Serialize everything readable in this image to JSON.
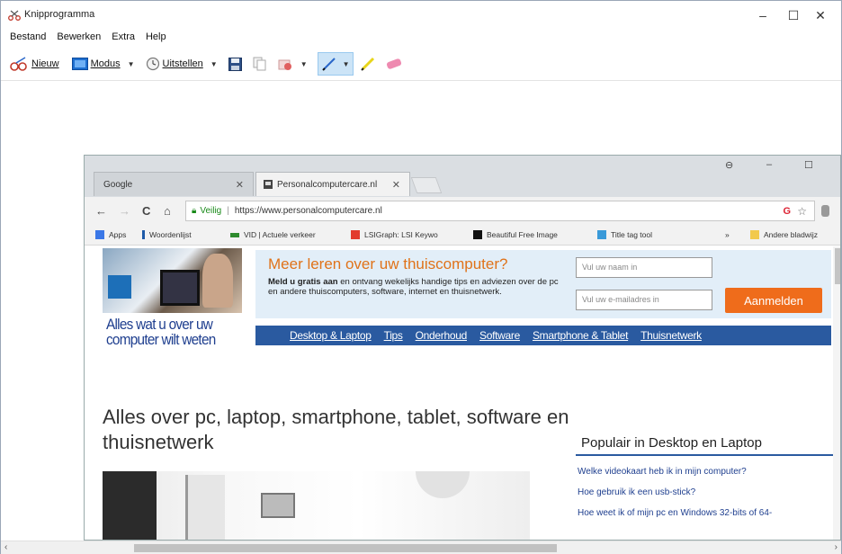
{
  "window": {
    "title": "Knipprogramma",
    "controls": [
      "–",
      "☐",
      "✕"
    ]
  },
  "menu": [
    "Bestand",
    "Bewerken",
    "Extra",
    "Help"
  ],
  "toolbar": {
    "new_label": "Nieuw",
    "mode_label": "Modus",
    "delay_label": "Uitstellen"
  },
  "browser": {
    "tabs": [
      {
        "label": "Google",
        "close": "✕"
      },
      {
        "label": "Personalcomputercare.nl",
        "close": "✕"
      }
    ],
    "window_controls": [
      "⊖",
      "–",
      "☐"
    ],
    "nav": {
      "back": "←",
      "forward": "→",
      "reload": "C",
      "home": "⌂"
    },
    "address": {
      "secure_label": "Veilig",
      "url": "https://www.personalcomputercare.nl"
    },
    "bookmarks": [
      {
        "label": "Apps",
        "color": "#3b78e7"
      },
      {
        "label": "Woordenlijst",
        "color": "#1e5aa8"
      },
      {
        "label": "VID | Actuele verkeer",
        "color": "#2e8b2e"
      },
      {
        "label": "LSIGraph: LSI Keywo",
        "color": "#e23b2e"
      },
      {
        "label": "Beautiful Free Image",
        "color": "#111111"
      },
      {
        "label": "Title tag tool",
        "color": "#3a9ad9"
      }
    ],
    "bookmarks_more": "»",
    "other_bookmarks": "Andere bladwijz"
  },
  "site": {
    "slogan": "Alles wat u over uw computer wilt weten",
    "promo": {
      "heading": "Meer leren over uw thuiscomputer?",
      "text_bold": "Meld u gratis aan",
      "text_rest": " en ontvang wekelijks handige tips en adviezen over de pc en andere thuiscomputers, software, internet en thuisnetwerk.",
      "name_placeholder": "Vul uw naam in",
      "email_placeholder": "Vul uw e-mailadres in",
      "button": "Aanmelden"
    },
    "nav": [
      "Desktop & Laptop",
      "Tips",
      "Onderhoud",
      "Software",
      "Smartphone & Tablet",
      "Thuisnetwerk"
    ],
    "headline": "Alles over pc, laptop, smartphone, tablet, software en thuisnetwerk",
    "sidebar": {
      "title": "Populair in Desktop en Laptop",
      "items": [
        "Welke videokaart heb ik in mijn computer?",
        "Hoe gebruik ik een usb-stick?",
        "Hoe weet ik of mijn pc en Windows 32-bits of 64-"
      ]
    }
  },
  "scrollbar": {
    "left": "‹",
    "right": "›"
  },
  "colors": {
    "accent": "#2a5aa0",
    "orange": "#ef6c1b",
    "promo_bg": "#e2eef8"
  }
}
